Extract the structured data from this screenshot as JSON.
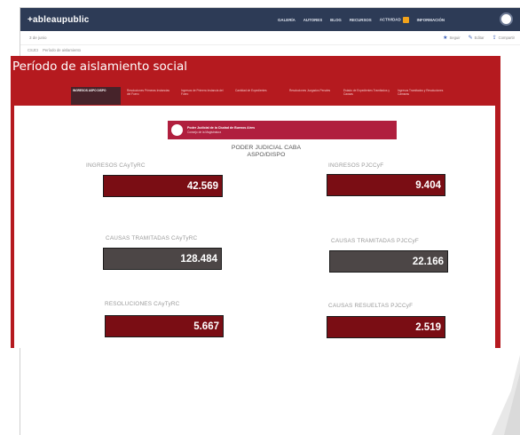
{
  "topbar": {
    "logo_main": "+ableau",
    "logo_plus": "+",
    "logo_tail": "public",
    "nav": [
      "GALERÍA",
      "AUTORES",
      "BLOG",
      "RECURSOS",
      "ACTIVIDAD",
      "INFORMACIÓN"
    ],
    "activity_badge_color": "#f2a31b"
  },
  "subbar": {
    "date": "3 de junio",
    "actions": [
      "Seguir",
      "Editar",
      "Compartir"
    ]
  },
  "crumbs": [
    "CSJCI",
    "Período de aislamiento"
  ],
  "dashboard": {
    "title": "Período de aislamiento social",
    "tabs": [
      "INGRESOS ASPO DISPO",
      "Resoluciones Primeras Instancias del Fuero",
      "Ingresos de Primera Instancia del Fuero",
      "Cantidad de Expedientes",
      "Resoluciones Juzgados Penales",
      "Estado de Expedientes Tramitados y Causas",
      "Ingresos Tramitados y Resoluciones Cámaras"
    ],
    "banner": {
      "line1": "Poder Judicial de la Ciudad de Buenos Aires",
      "line2": "Consejo de la Magistratura"
    },
    "main_title_1": "PODER JUDICIAL CABA",
    "main_title_2": "ASPO/DISPO",
    "kpis": {
      "ingresos_caytrc": {
        "label": "INGRESOS CAyTyRC",
        "value": "42.569"
      },
      "ingresos_pjcyf": {
        "label": "INGRESOS PJCCyF",
        "value": "9.404"
      },
      "causas_tramitadas_caytrc": {
        "label": "CAUSAS TRAMITADAS CAyTyRC",
        "value": "128.484"
      },
      "causas_tramitadas_pjcyf": {
        "label": "CAUSAS TRAMITADAS PJCCyF",
        "value": "22.166"
      },
      "resoluciones_caytrc": {
        "label": "RESOLUCIONES CAyTyRC",
        "value": "5.667"
      },
      "causas_resueltas_pjcyf": {
        "label": "CAUSAS RESUELTAS PJCCyF",
        "value": "2.519"
      }
    },
    "colors": {
      "header_red": "#b51a1f",
      "kpi_red": "#7a0d14",
      "kpi_gray": "#4c4646",
      "banner": "#b01f3e"
    }
  }
}
